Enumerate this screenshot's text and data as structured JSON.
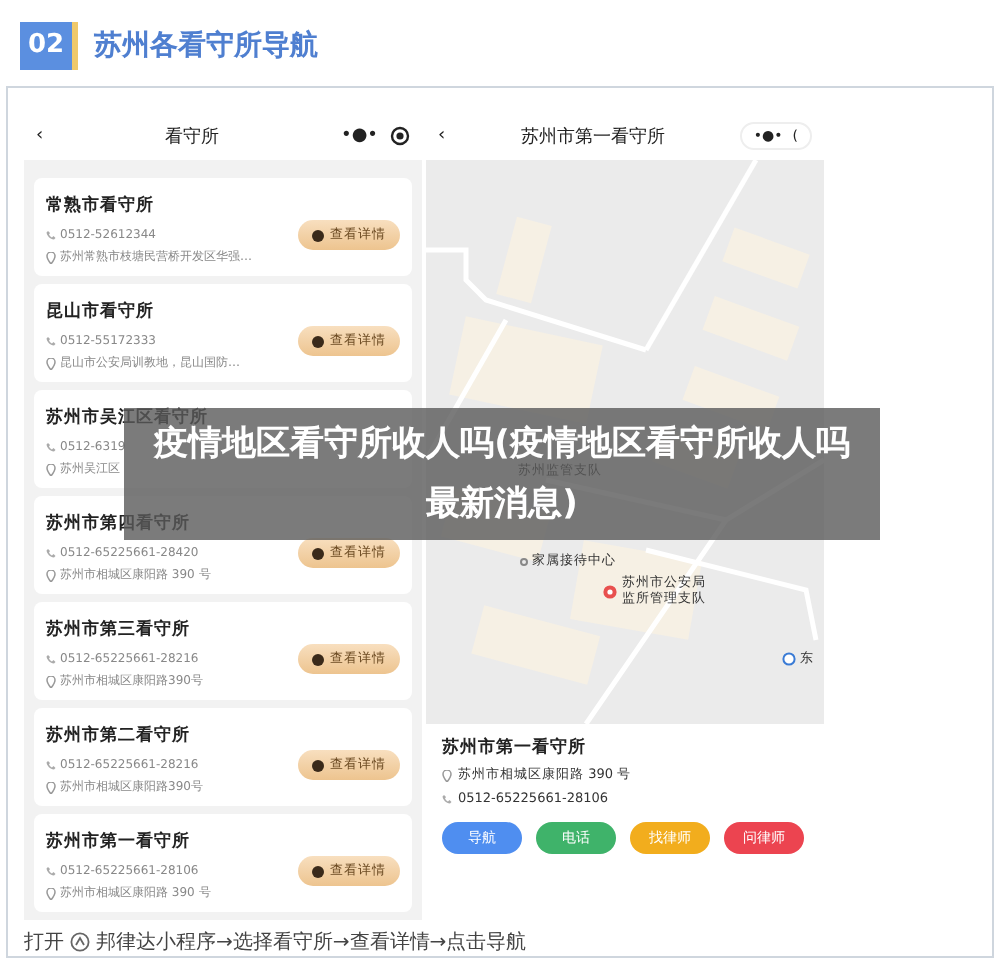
{
  "header": {
    "number": "02",
    "title": "苏州各看守所导航"
  },
  "list_screen": {
    "back": "‹",
    "title": "看守所",
    "menu": "•●•",
    "items": [
      {
        "name": "常熟市看守所",
        "phone": "0512-52612344",
        "address": "苏州常熟市枝塘民营桥开发区华强…",
        "button": "查看详情"
      },
      {
        "name": "昆山市看守所",
        "phone": "0512-55172333",
        "address": "昆山市公安局训教地，昆山国防…",
        "button": "查看详情"
      },
      {
        "name": "苏州市吴江区看守所",
        "phone": "0512-6319",
        "address": "苏州吴江区"
      },
      {
        "name": "苏州市第四看守所",
        "phone": "0512-65225661-28420",
        "address": "苏州市相城区康阳路 390 号",
        "button": "查看详情"
      },
      {
        "name": "苏州市第三看守所",
        "phone": "0512-65225661-28216",
        "address": "苏州市相城区康阳路390号",
        "button": "查看详情"
      },
      {
        "name": "苏州市第二看守所",
        "phone": "0512-65225661-28216",
        "address": "苏州市相城区康阳路390号",
        "button": "查看详情"
      },
      {
        "name": "苏州市第一看守所",
        "phone": "0512-65225661-28106",
        "address": "苏州市相城区康阳路 390 号",
        "button": "查看详情"
      }
    ]
  },
  "detail_screen": {
    "back": "‹",
    "title": "苏州市第一看守所",
    "menu": "•●•",
    "capsule_edge": "(",
    "map_labels": [
      {
        "kind": "plain",
        "lines": [
          "苏州监管支队"
        ]
      },
      {
        "kind": "dot",
        "lines": [
          "家属接待中心"
        ]
      },
      {
        "kind": "pin",
        "lines": [
          "苏州市公安局",
          "监所管理支队"
        ]
      },
      {
        "kind": "station",
        "lines": [
          "东"
        ]
      }
    ],
    "name": "苏州市第一看守所",
    "address": "苏州市相城区康阳路 390 号",
    "phone": "0512-65225661-28106",
    "actions": [
      {
        "label": "导航",
        "color": "#4f8ef0"
      },
      {
        "label": "电话",
        "color": "#3fb36a"
      },
      {
        "label": "找律师",
        "color": "#f2ad1d"
      },
      {
        "label": "问律师",
        "color": "#ec4450"
      }
    ]
  },
  "caption": {
    "before": "打开",
    "after": "邦律达小程序→选择看守所→查看详情→点击导航"
  },
  "overlay_title": "疫情地区看守所收人吗(疫情地区看守所收人吗最新消息)"
}
